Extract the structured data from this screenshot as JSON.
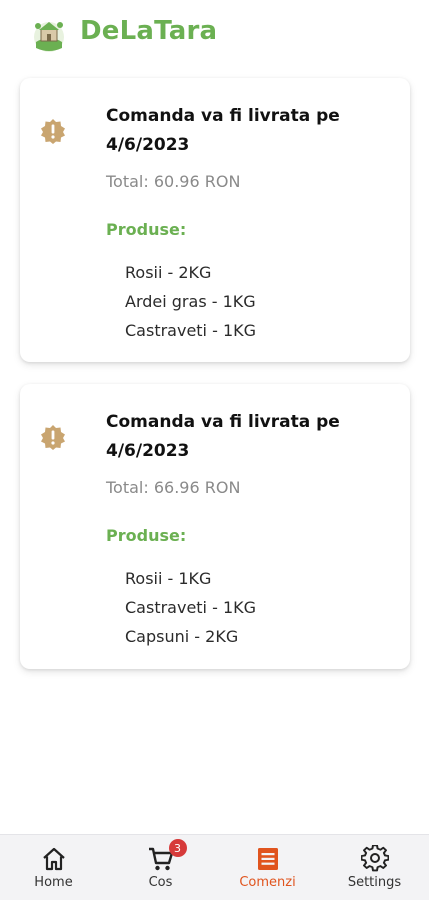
{
  "header": {
    "title": "DeLaTara",
    "brand_color": "#6bb052",
    "logo_icon": "farm-logo-icon"
  },
  "orders": [
    {
      "status_icon": "warning-badge-icon",
      "title": "Comanda va fi livrata pe 4/6/2023",
      "total": "Total: 60.96 RON",
      "products_label": "Produse:",
      "products": [
        "Rosii - 2KG",
        "Ardei gras - 1KG",
        "Castraveti - 1KG"
      ]
    },
    {
      "status_icon": "warning-badge-icon",
      "title": "Comanda va fi livrata pe 4/6/2023",
      "total": "Total: 66.96 RON",
      "products_label": "Produse:",
      "products": [
        "Rosii - 1KG",
        "Castraveti - 1KG",
        "Capsuni - 2KG"
      ]
    }
  ],
  "nav": {
    "items": [
      {
        "label": "Home",
        "icon": "home-icon"
      },
      {
        "label": "Cos",
        "icon": "cart-icon",
        "badge": "3"
      },
      {
        "label": "Comenzi",
        "icon": "orders-icon",
        "active": true
      },
      {
        "label": "Settings",
        "icon": "gear-icon"
      }
    ],
    "active_color": "#e0541e",
    "badge_color": "#d63a3a"
  },
  "colors": {
    "status_icon": "#c9a570"
  }
}
